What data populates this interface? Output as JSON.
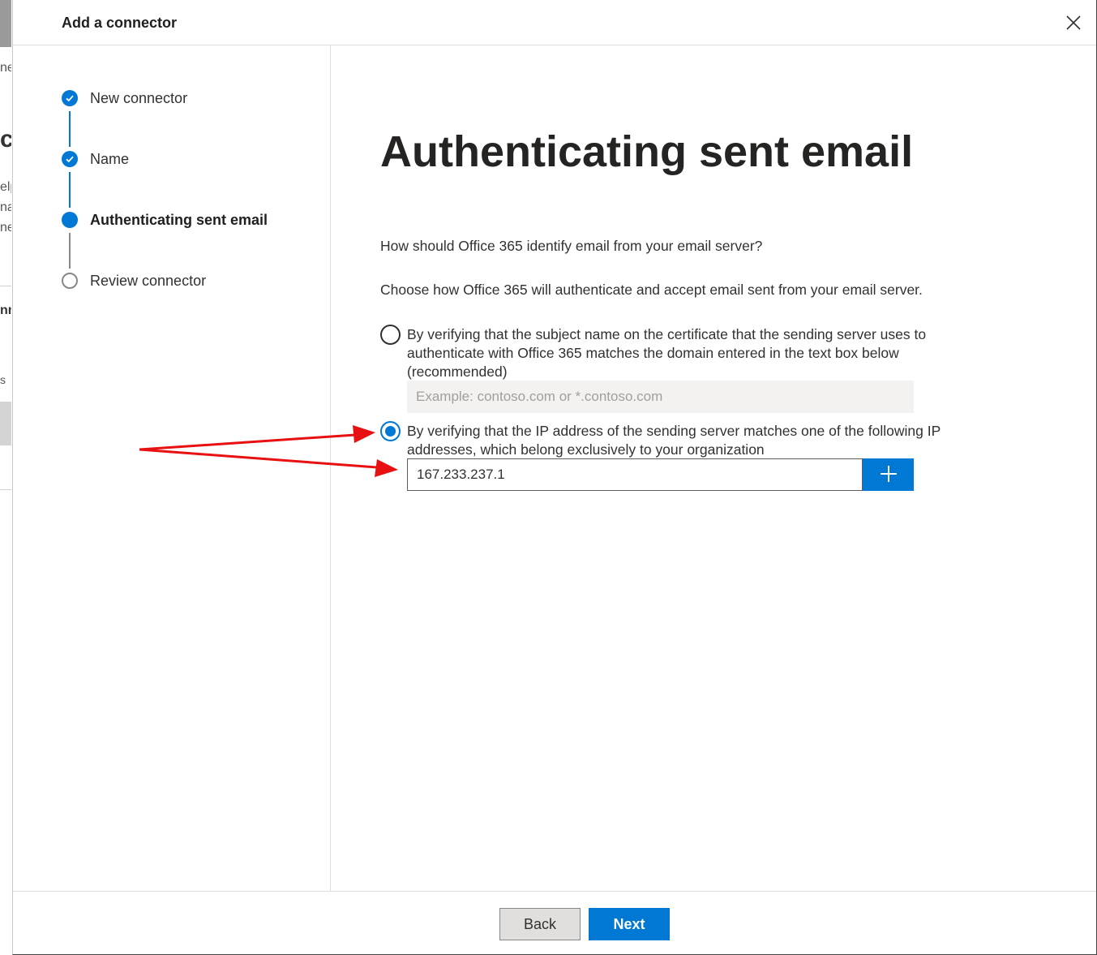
{
  "background_fragments": [
    "ne",
    "ct",
    "elp",
    "nat",
    "ner",
    "nn",
    "s"
  ],
  "panel": {
    "title": "Add a connector",
    "close_icon": "close-icon"
  },
  "steps": [
    {
      "label": "New connector",
      "status": "completed",
      "icon": "checkmark-icon"
    },
    {
      "label": "Name",
      "status": "completed",
      "icon": "checkmark-icon"
    },
    {
      "label": "Authenticating sent email",
      "status": "current",
      "icon": "filled-dot"
    },
    {
      "label": "Review connector",
      "status": "pending",
      "icon": "empty-circle"
    }
  ],
  "main": {
    "heading": "Authenticating sent email",
    "question": "How should Office 365 identify email from your email server?",
    "instruction": "Choose how Office 365 will authenticate and accept email sent from your email server.",
    "option_certificate": {
      "label": "By verifying that the subject name on the certificate that the sending server uses to authenticate with Office 365 matches the domain entered in the text box below (recommended)",
      "selected": false,
      "placeholder": "Example: contoso.com or *.contoso.com",
      "value": ""
    },
    "option_ip": {
      "label": "By verifying that the IP address of the sending server matches one of the following IP addresses, which belong exclusively to your organization",
      "selected": true,
      "value": "167.233.237.1",
      "add_icon": "plus-icon"
    }
  },
  "footer": {
    "back_label": "Back",
    "next_label": "Next"
  },
  "colors": {
    "accent": "#0078d4",
    "annotation_arrow": "#e81010"
  }
}
